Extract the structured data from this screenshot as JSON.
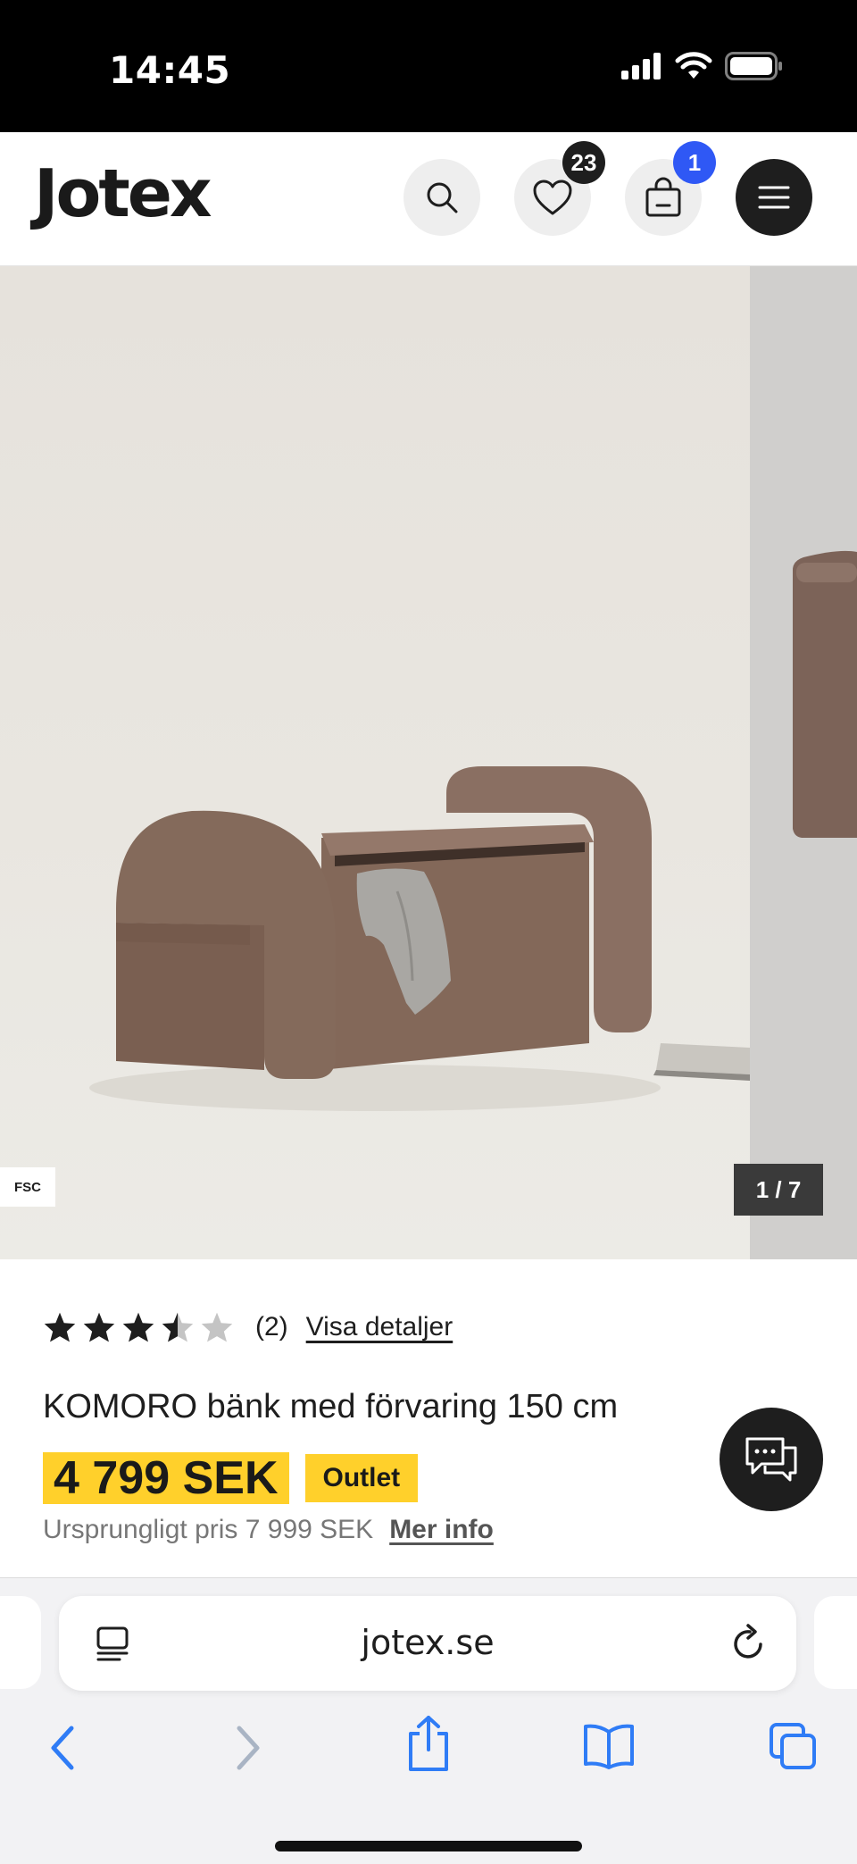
{
  "status_bar": {
    "time": "14:45"
  },
  "header": {
    "logo": "Jotex",
    "wishlist_count": "23",
    "cart_count": "1"
  },
  "gallery": {
    "fsc_label": "FSC",
    "counter": "1 / 7"
  },
  "product": {
    "rating": 3.5,
    "rating_max": 5,
    "review_count": "(2)",
    "details_link": "Visa detaljer",
    "title": "KOMORO bänk med förvaring 150 cm",
    "price": "4 799 SEK",
    "outlet_badge": "Outlet",
    "original_price": "Ursprungligt pris 7 999 SEK",
    "more_info": "Mer info"
  },
  "browser": {
    "url": "jotex.se"
  },
  "colors": {
    "accent_yellow": "#ffd02b",
    "badge_blue": "#2f58f5",
    "safari_blue": "#2f7cf6",
    "dark": "#1e1e1e"
  }
}
